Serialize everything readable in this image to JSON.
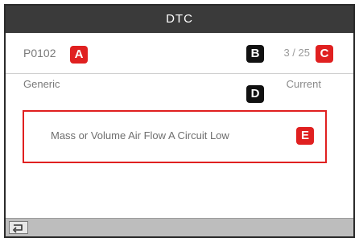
{
  "window": {
    "title": "DTC"
  },
  "dtc": {
    "code": "P0102",
    "counter": "3 / 25",
    "type": "Generic",
    "status": "Current",
    "description": "Mass or Volume Air Flow A Circuit Low"
  },
  "callouts": {
    "a": "A",
    "b": "B",
    "c": "C",
    "d": "D",
    "e": "E"
  },
  "colors": {
    "callout_red": "#e02020",
    "callout_black": "#111111",
    "highlight_border": "#e02020",
    "titlebar": "#3a3a3a"
  },
  "icons": {
    "back": "back-arrow-icon"
  }
}
